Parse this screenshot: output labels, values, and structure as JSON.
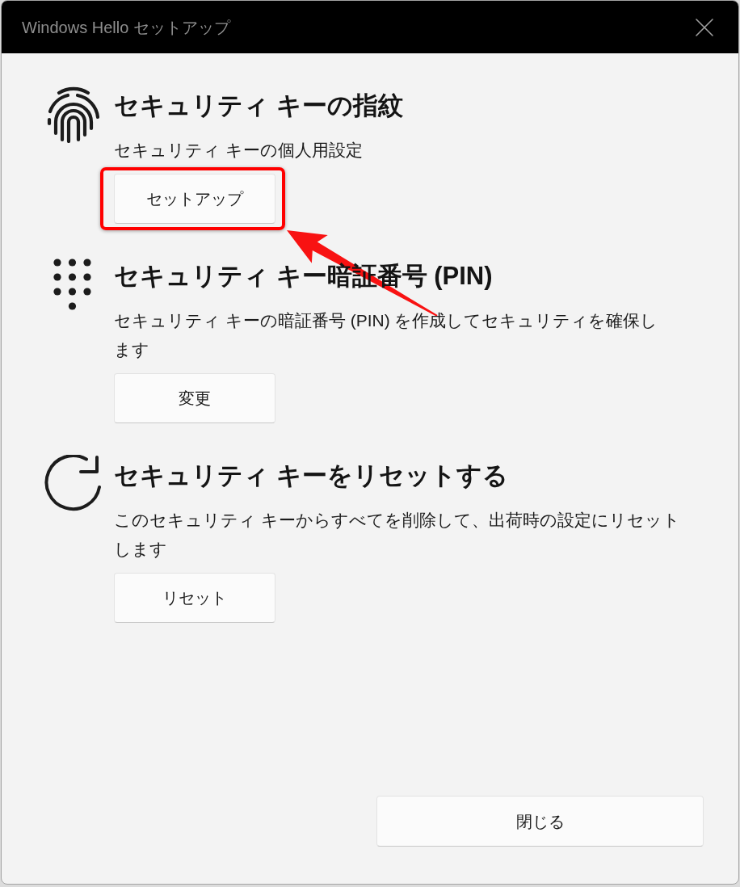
{
  "window": {
    "title": "Windows Hello セットアップ"
  },
  "sections": [
    {
      "kind": "fingerprint",
      "heading": "セキュリティ キーの指紋",
      "description": "セキュリティ キーの個人用設定",
      "button": "セットアップ",
      "highlighted": true
    },
    {
      "kind": "keypad",
      "heading": "セキュリティ キー暗証番号 (PIN)",
      "description": "セキュリティ キーの暗証番号 (PIN) を作成してセキュリティを確保します",
      "button": "変更",
      "highlighted": false
    },
    {
      "kind": "reset",
      "heading": "セキュリティ キーをリセットする",
      "description": "このセキュリティ キーからすべてを削除して、出荷時の設定にリセットします",
      "button": "リセット",
      "highlighted": false
    }
  ],
  "footer": {
    "close_button": "閉じる"
  }
}
